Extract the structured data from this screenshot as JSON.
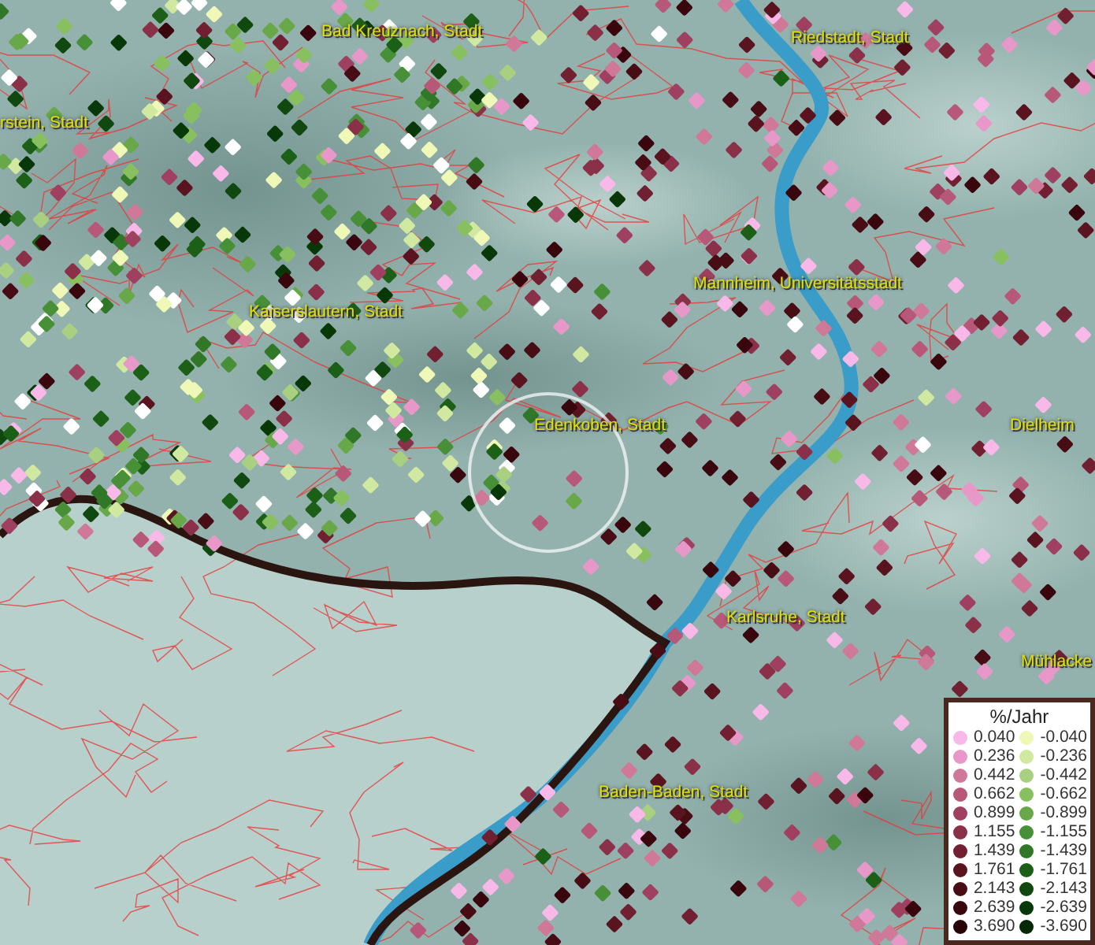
{
  "map": {
    "places": [
      {
        "name": "rstein, Stadt"
      },
      {
        "name": "Bad Kreuznach, Stadt"
      },
      {
        "name": "Riedstadt, Stadt"
      },
      {
        "name": "Kaiserslautern, Stadt"
      },
      {
        "name": "Mannheim, Universitätsstadt"
      },
      {
        "name": "Edenkoben, Stadt"
      },
      {
        "name": "Dielheim"
      },
      {
        "name": "Karlsruhe, Stadt"
      },
      {
        "name": "Mühlacke"
      },
      {
        "name": "Baden-Baden, Stadt"
      }
    ]
  },
  "legend": {
    "title": "%/Jahr",
    "rows": [
      {
        "positive": {
          "label": "0.040",
          "color": "#f8b8e8"
        },
        "negative": {
          "label": "-0.040",
          "color": "#f0f8b8"
        }
      },
      {
        "positive": {
          "label": "0.236",
          "color": "#e898c8"
        },
        "negative": {
          "label": "-0.236",
          "color": "#d0e8a0"
        }
      },
      {
        "positive": {
          "label": "0.442",
          "color": "#d07898"
        },
        "negative": {
          "label": "-0.442",
          "color": "#a8d080"
        }
      },
      {
        "positive": {
          "label": "0.662",
          "color": "#b85878"
        },
        "negative": {
          "label": "-0.662",
          "color": "#88c060"
        }
      },
      {
        "positive": {
          "label": "0.899",
          "color": "#a04060"
        },
        "negative": {
          "label": "-0.899",
          "color": "#68a848"
        }
      },
      {
        "positive": {
          "label": "1.155",
          "color": "#8a3048"
        },
        "negative": {
          "label": "-1.155",
          "color": "#489038"
        }
      },
      {
        "positive": {
          "label": "1.439",
          "color": "#702030"
        },
        "negative": {
          "label": "-1.439",
          "color": "#307828"
        }
      },
      {
        "positive": {
          "label": "1.761",
          "color": "#5a1420"
        },
        "negative": {
          "label": "-1.761",
          "color": "#1c6018"
        }
      },
      {
        "positive": {
          "label": "2.143",
          "color": "#480c14"
        },
        "negative": {
          "label": "-2.143",
          "color": "#104810"
        }
      },
      {
        "positive": {
          "label": "2.639",
          "color": "#38060c"
        },
        "negative": {
          "label": "-2.639",
          "color": "#083808"
        }
      },
      {
        "positive": {
          "label": "3.690",
          "color": "#280408"
        },
        "negative": {
          "label": "-3.690",
          "color": "#042804"
        }
      }
    ]
  }
}
